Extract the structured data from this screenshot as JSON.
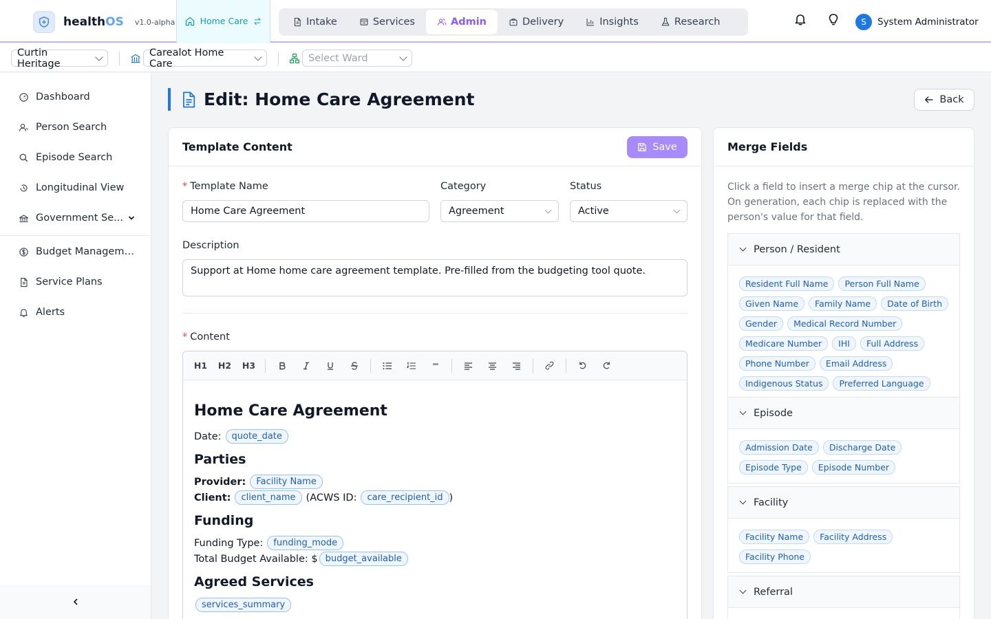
{
  "brand": {
    "name_prefix": "health",
    "name_suffix": "OS",
    "version": "v1.0-alpha"
  },
  "context_tab": {
    "label": "Home Care"
  },
  "nav": [
    {
      "label": "Intake",
      "icon": "document-icon"
    },
    {
      "label": "Services",
      "icon": "services-icon"
    },
    {
      "label": "Admin",
      "icon": "users-icon",
      "active": true
    },
    {
      "label": "Delivery",
      "icon": "delivery-icon"
    },
    {
      "label": "Insights",
      "icon": "chart-icon"
    },
    {
      "label": "Research",
      "icon": "flask-icon"
    }
  ],
  "user": {
    "initial": "S",
    "name": "System Administrator"
  },
  "context": {
    "organisation": "Curtin Heritage",
    "facility": "Carealot Home Care",
    "ward_placeholder": "Select Ward"
  },
  "sidebar": {
    "items": [
      {
        "label": "Dashboard",
        "icon": "dashboard-icon"
      },
      {
        "label": "Person Search",
        "icon": "person-search-icon"
      },
      {
        "label": "Episode Search",
        "icon": "search-icon"
      },
      {
        "label": "Longitudinal View",
        "icon": "history-icon"
      },
      {
        "label": "Government Se...",
        "icon": "government-icon"
      },
      {
        "label": "Budget Manageme...",
        "icon": "dollar-icon"
      },
      {
        "label": "Service Plans",
        "icon": "file-icon"
      },
      {
        "label": "Alerts",
        "icon": "bell-icon"
      }
    ]
  },
  "page": {
    "title": "Edit: Home Care Agreement",
    "back_label": "Back"
  },
  "template": {
    "card_title": "Template Content",
    "save_label": "Save",
    "name_label": "Template Name",
    "name_value": "Home Care Agreement",
    "category_label": "Category",
    "category_value": "Agreement",
    "status_label": "Status",
    "status_value": "Active",
    "description_label": "Description",
    "description_value": "Support at Home home care agreement template. Pre-filled from the budgeting tool quote.",
    "content_label": "Content"
  },
  "toolbar": {
    "h1": "H1",
    "h2": "H2",
    "h3": "H3"
  },
  "doc": {
    "title": "Home Care Agreement",
    "date_label": "Date:",
    "date_chip": "quote_date",
    "parties_heading": "Parties",
    "provider_label": "Provider:",
    "provider_chip": "Facility Name",
    "client_label": "Client:",
    "client_chip": "client_name",
    "acws_prefix": "(ACWS ID:",
    "acws_chip": "care_recipient_id",
    "acws_suffix": ")",
    "funding_heading": "Funding",
    "funding_type_label": "Funding Type:",
    "funding_type_chip": "funding_mode",
    "budget_label": "Total Budget Available: $",
    "budget_chip": "budget_available",
    "services_heading": "Agreed Services",
    "services_chip": "services_summary"
  },
  "merge": {
    "title": "Merge Fields",
    "description": "Click a field to insert a merge chip at the cursor. On generation, each chip is replaced with the person's value for that field.",
    "groups": [
      {
        "title": "Person / Resident",
        "fields": [
          "Resident Full Name",
          "Person Full Name",
          "Given Name",
          "Family Name",
          "Date of Birth",
          "Gender",
          "Medical Record Number",
          "Medicare Number",
          "IHI",
          "Full Address",
          "Phone Number",
          "Email Address",
          "Indigenous Status",
          "Preferred Language"
        ]
      },
      {
        "title": "Episode",
        "fields": [
          "Admission Date",
          "Discharge Date",
          "Episode Type",
          "Episode Number"
        ]
      },
      {
        "title": "Facility",
        "fields": [
          "Facility Name",
          "Facility Address",
          "Facility Phone"
        ]
      },
      {
        "title": "Referral",
        "fields": []
      }
    ]
  },
  "colors": {
    "accent": "#8b5cf6",
    "brand_blue": "#1e78e4",
    "teal": "#0e9fb3",
    "chip": "#1d5fbf"
  }
}
